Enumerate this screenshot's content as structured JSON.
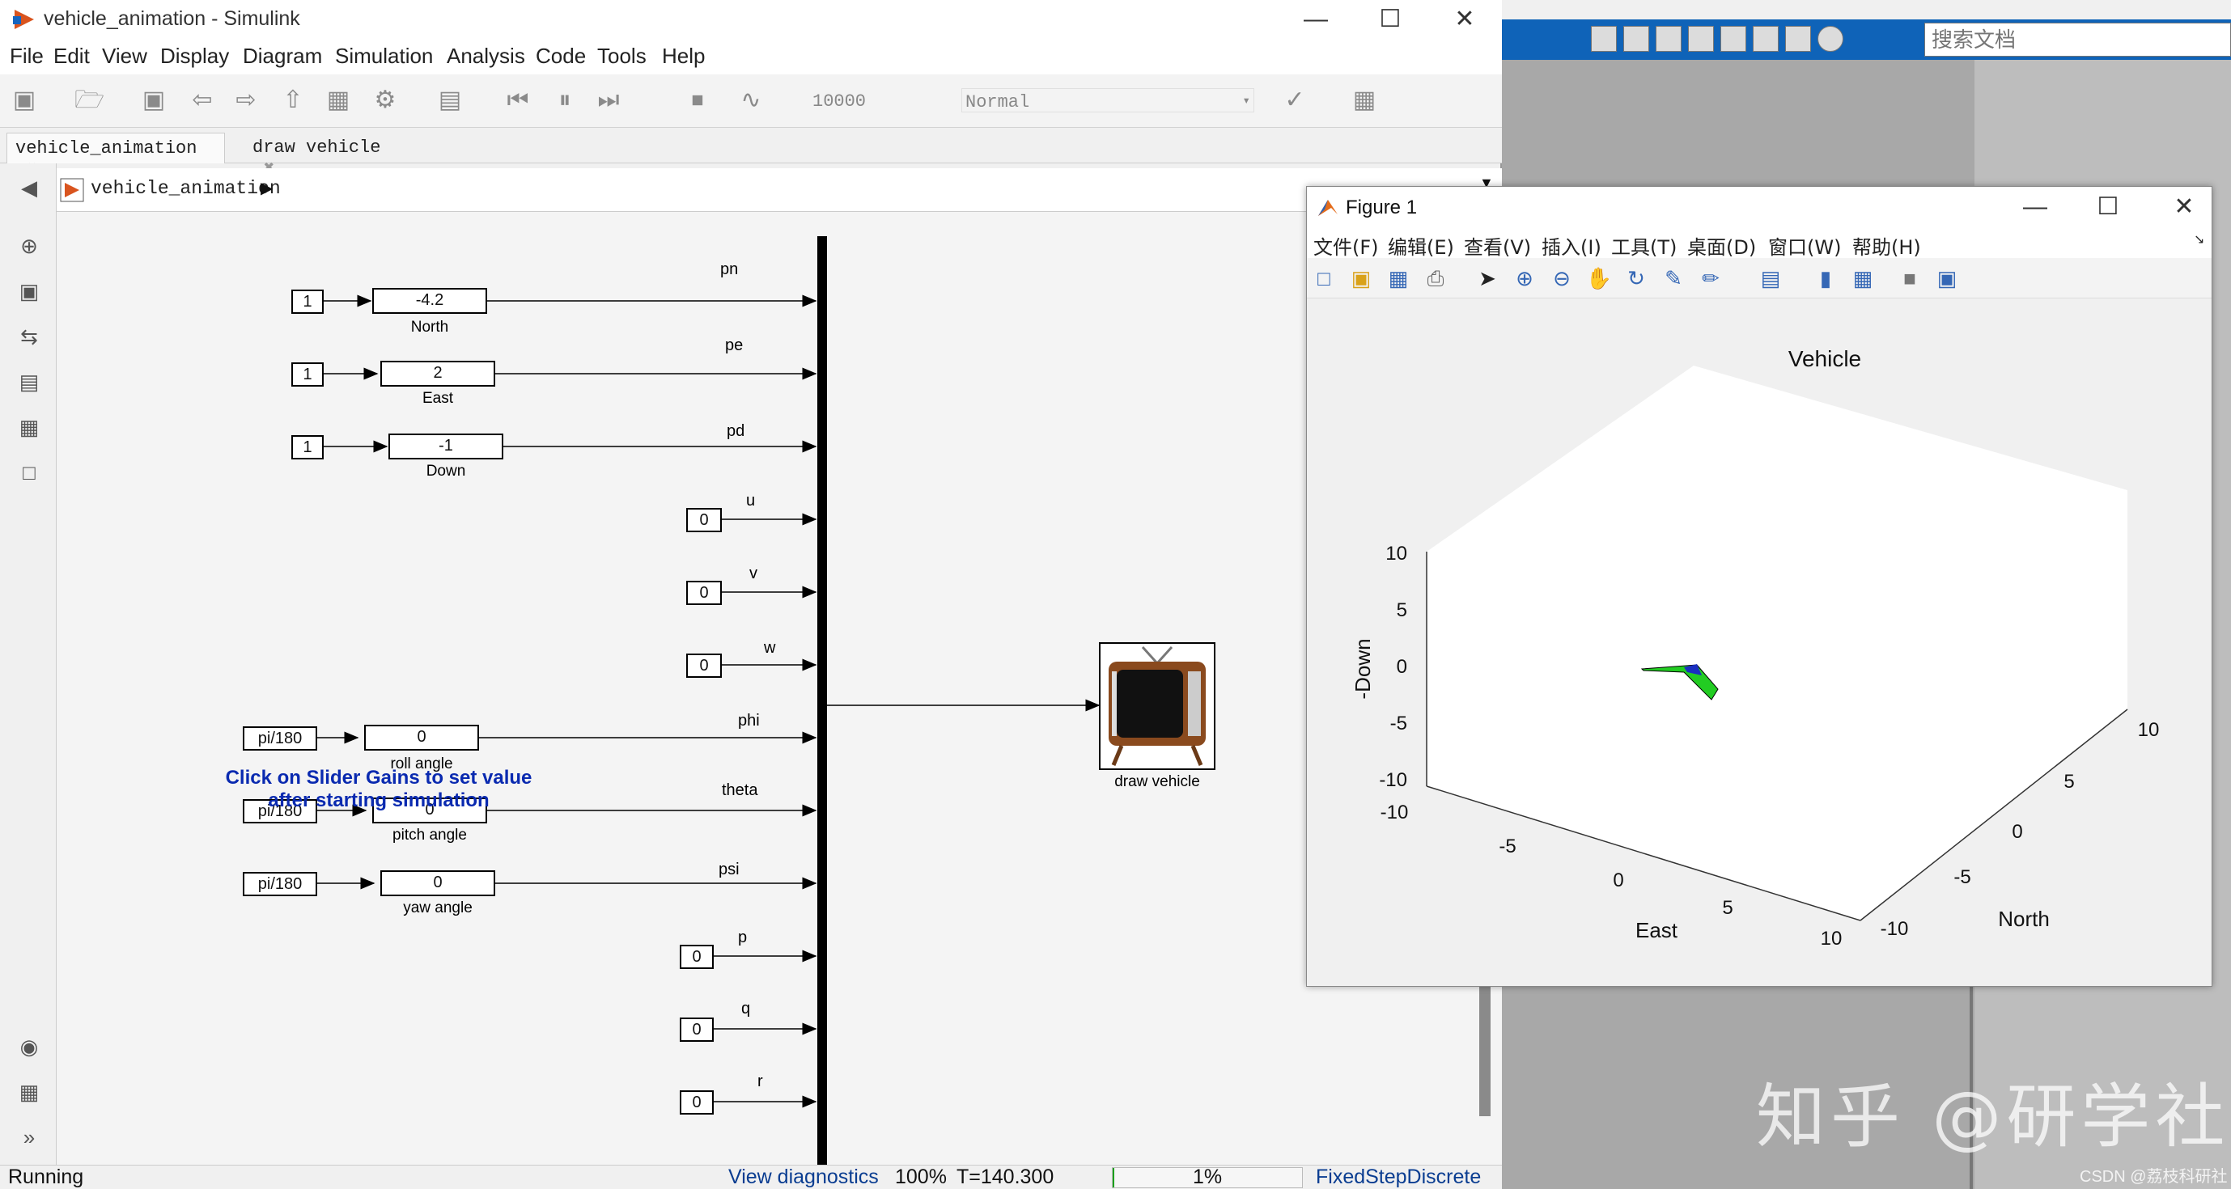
{
  "simulink": {
    "title": "vehicle_animation - Simulink",
    "menu": [
      "File",
      "Edit",
      "View",
      "Display",
      "Diagram",
      "Simulation",
      "Analysis",
      "Code",
      "Tools",
      "Help"
    ],
    "stop_time": "10000",
    "sim_mode": "Normal",
    "tabs": [
      "vehicle_animation",
      "draw vehicle"
    ],
    "breadcrumb": "vehicle_animation",
    "status": {
      "state": "Running",
      "diagnostics": "View diagnostics",
      "zoom": "100%",
      "time": "T=140.300",
      "progress": "1%",
      "solver": "FixedStepDiscrete"
    }
  },
  "diagram": {
    "hint_line1": "Click on Slider Gains to set value",
    "hint_line2": "after starting simulation",
    "sources": [
      {
        "const": "1",
        "gain": "-4.2",
        "label": "North",
        "signal": "pn"
      },
      {
        "const": "1",
        "gain": "2",
        "label": "East",
        "signal": "pe"
      },
      {
        "const": "1",
        "gain": "-1",
        "label": "Down",
        "signal": "pd"
      },
      {
        "const": "0",
        "signal": "u"
      },
      {
        "const": "0",
        "signal": "v"
      },
      {
        "const": "0",
        "signal": "w"
      },
      {
        "const": "pi/180",
        "gain": "0",
        "label": "roll angle",
        "signal": "phi"
      },
      {
        "const": "pi/180",
        "gain": "0",
        "label": "pitch angle",
        "signal": "theta"
      },
      {
        "const": "pi/180",
        "gain": "0",
        "label": "yaw angle",
        "signal": "psi"
      },
      {
        "const": "0",
        "signal": "p"
      },
      {
        "const": "0",
        "signal": "q"
      },
      {
        "const": "0",
        "signal": "r"
      }
    ],
    "output_block": "draw vehicle"
  },
  "figure": {
    "title": "Figure 1",
    "menu": [
      "文件(F)",
      "编辑(E)",
      "查看(V)",
      "插入(I)",
      "工具(T)",
      "桌面(D)",
      "窗口(W)",
      "帮助(H)"
    ],
    "plot_title": "Vehicle",
    "zlabel": "-Down",
    "xlabel": "East",
    "ylabel": "North",
    "z_ticks": [
      "10",
      "5",
      "0",
      "-5",
      "-10"
    ],
    "east_ticks": [
      "-10",
      "-5",
      "0",
      "5",
      "10"
    ],
    "north_ticks": [
      "-10",
      "-5",
      "0",
      "5",
      "10"
    ],
    "vehicle_colors": {
      "body": "#22cc22",
      "nose": "#1a2fbf"
    }
  },
  "background_app": {
    "search_placeholder": "搜索文档",
    "watermark": "知乎 @研学社",
    "csdn": "CSDN @荔枝科研社"
  },
  "colors": {
    "hint": "#0a2ab0",
    "scrollbar": "#8a8a8a"
  }
}
